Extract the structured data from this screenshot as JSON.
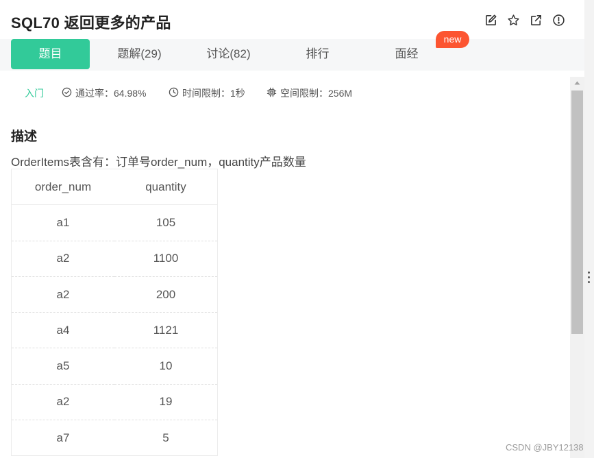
{
  "header": {
    "title": "SQL70  返回更多的产品",
    "icons": [
      "edit-icon",
      "star-icon",
      "external-link-icon",
      "info-icon"
    ]
  },
  "tabs": [
    {
      "label": "题目",
      "active": true
    },
    {
      "label": "题解(29)",
      "active": false
    },
    {
      "label": "讨论(82)",
      "active": false
    },
    {
      "label": "排行",
      "active": false
    },
    {
      "label": "面经",
      "active": false
    }
  ],
  "new_badge": "new",
  "meta": {
    "level": "入门",
    "pass_rate": "通过率：64.98%",
    "time_limit": "时间限制：1秒",
    "space_limit": "空间限制：256M"
  },
  "description": {
    "heading": "描述",
    "text": "OrderItems表含有：订单号order_num，quantity产品数量"
  },
  "table": {
    "headers": [
      "order_num",
      "quantity"
    ],
    "rows": [
      [
        "a1",
        "105"
      ],
      [
        "a2",
        "1100"
      ],
      [
        "a2",
        "200"
      ],
      [
        "a4",
        "1121"
      ],
      [
        "a5",
        "10"
      ],
      [
        "a2",
        "19"
      ],
      [
        "a7",
        "5"
      ]
    ]
  },
  "watermark": "CSDN @JBY12138",
  "colors": {
    "accent": "#32ca99",
    "badge": "#fc5531",
    "tab_bar_bg": "#f6f7f8"
  }
}
